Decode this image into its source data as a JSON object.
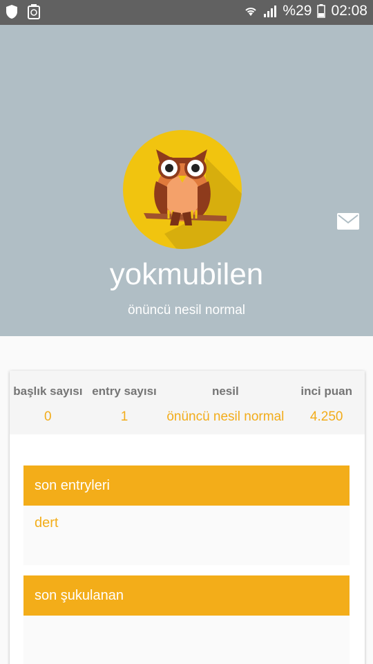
{
  "status_bar": {
    "battery_percent": "%29",
    "time": "02:08",
    "left_icons": [
      "shield-icon",
      "recycle-icon"
    ],
    "right_icons": [
      "wifi-icon",
      "signal-icon",
      "battery-icon"
    ]
  },
  "profile": {
    "username": "yokmubilen",
    "generation_label": "önüncü nesil normal",
    "avatar_icon": "owl-avatar-icon",
    "message_icon": "envelope-icon"
  },
  "stats": [
    {
      "label": "başlık sayısı",
      "value": "0"
    },
    {
      "label": "entry sayısı",
      "value": "1"
    },
    {
      "label": "nesil",
      "value": "önüncü nesil normal"
    },
    {
      "label": "inci puan",
      "value": "4.250"
    }
  ],
  "sections": {
    "recent_entries": {
      "title": "son entryleri",
      "items": [
        "dert"
      ]
    },
    "recent_upvoted": {
      "title": "son şukulanan",
      "items": []
    }
  },
  "colors": {
    "header_bg": "#b0bec5",
    "accent": "#f3ad19",
    "statusbar_bg": "#616161",
    "avatar_circle": "#f1c40f"
  }
}
